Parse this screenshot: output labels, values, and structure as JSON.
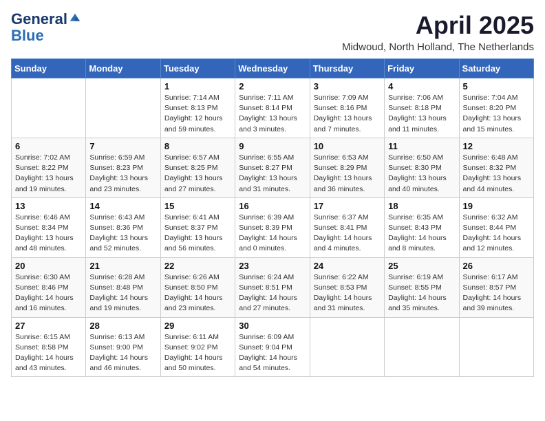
{
  "logo": {
    "line1": "General",
    "line2": "Blue"
  },
  "title": "April 2025",
  "subtitle": "Midwoud, North Holland, The Netherlands",
  "weekdays": [
    "Sunday",
    "Monday",
    "Tuesday",
    "Wednesday",
    "Thursday",
    "Friday",
    "Saturday"
  ],
  "weeks": [
    [
      {
        "day": "",
        "info": ""
      },
      {
        "day": "",
        "info": ""
      },
      {
        "day": "1",
        "info": "Sunrise: 7:14 AM\nSunset: 8:13 PM\nDaylight: 12 hours\nand 59 minutes."
      },
      {
        "day": "2",
        "info": "Sunrise: 7:11 AM\nSunset: 8:14 PM\nDaylight: 13 hours\nand 3 minutes."
      },
      {
        "day": "3",
        "info": "Sunrise: 7:09 AM\nSunset: 8:16 PM\nDaylight: 13 hours\nand 7 minutes."
      },
      {
        "day": "4",
        "info": "Sunrise: 7:06 AM\nSunset: 8:18 PM\nDaylight: 13 hours\nand 11 minutes."
      },
      {
        "day": "5",
        "info": "Sunrise: 7:04 AM\nSunset: 8:20 PM\nDaylight: 13 hours\nand 15 minutes."
      }
    ],
    [
      {
        "day": "6",
        "info": "Sunrise: 7:02 AM\nSunset: 8:22 PM\nDaylight: 13 hours\nand 19 minutes."
      },
      {
        "day": "7",
        "info": "Sunrise: 6:59 AM\nSunset: 8:23 PM\nDaylight: 13 hours\nand 23 minutes."
      },
      {
        "day": "8",
        "info": "Sunrise: 6:57 AM\nSunset: 8:25 PM\nDaylight: 13 hours\nand 27 minutes."
      },
      {
        "day": "9",
        "info": "Sunrise: 6:55 AM\nSunset: 8:27 PM\nDaylight: 13 hours\nand 31 minutes."
      },
      {
        "day": "10",
        "info": "Sunrise: 6:53 AM\nSunset: 8:29 PM\nDaylight: 13 hours\nand 36 minutes."
      },
      {
        "day": "11",
        "info": "Sunrise: 6:50 AM\nSunset: 8:30 PM\nDaylight: 13 hours\nand 40 minutes."
      },
      {
        "day": "12",
        "info": "Sunrise: 6:48 AM\nSunset: 8:32 PM\nDaylight: 13 hours\nand 44 minutes."
      }
    ],
    [
      {
        "day": "13",
        "info": "Sunrise: 6:46 AM\nSunset: 8:34 PM\nDaylight: 13 hours\nand 48 minutes."
      },
      {
        "day": "14",
        "info": "Sunrise: 6:43 AM\nSunset: 8:36 PM\nDaylight: 13 hours\nand 52 minutes."
      },
      {
        "day": "15",
        "info": "Sunrise: 6:41 AM\nSunset: 8:37 PM\nDaylight: 13 hours\nand 56 minutes."
      },
      {
        "day": "16",
        "info": "Sunrise: 6:39 AM\nSunset: 8:39 PM\nDaylight: 14 hours\nand 0 minutes."
      },
      {
        "day": "17",
        "info": "Sunrise: 6:37 AM\nSunset: 8:41 PM\nDaylight: 14 hours\nand 4 minutes."
      },
      {
        "day": "18",
        "info": "Sunrise: 6:35 AM\nSunset: 8:43 PM\nDaylight: 14 hours\nand 8 minutes."
      },
      {
        "day": "19",
        "info": "Sunrise: 6:32 AM\nSunset: 8:44 PM\nDaylight: 14 hours\nand 12 minutes."
      }
    ],
    [
      {
        "day": "20",
        "info": "Sunrise: 6:30 AM\nSunset: 8:46 PM\nDaylight: 14 hours\nand 16 minutes."
      },
      {
        "day": "21",
        "info": "Sunrise: 6:28 AM\nSunset: 8:48 PM\nDaylight: 14 hours\nand 19 minutes."
      },
      {
        "day": "22",
        "info": "Sunrise: 6:26 AM\nSunset: 8:50 PM\nDaylight: 14 hours\nand 23 minutes."
      },
      {
        "day": "23",
        "info": "Sunrise: 6:24 AM\nSunset: 8:51 PM\nDaylight: 14 hours\nand 27 minutes."
      },
      {
        "day": "24",
        "info": "Sunrise: 6:22 AM\nSunset: 8:53 PM\nDaylight: 14 hours\nand 31 minutes."
      },
      {
        "day": "25",
        "info": "Sunrise: 6:19 AM\nSunset: 8:55 PM\nDaylight: 14 hours\nand 35 minutes."
      },
      {
        "day": "26",
        "info": "Sunrise: 6:17 AM\nSunset: 8:57 PM\nDaylight: 14 hours\nand 39 minutes."
      }
    ],
    [
      {
        "day": "27",
        "info": "Sunrise: 6:15 AM\nSunset: 8:58 PM\nDaylight: 14 hours\nand 43 minutes."
      },
      {
        "day": "28",
        "info": "Sunrise: 6:13 AM\nSunset: 9:00 PM\nDaylight: 14 hours\nand 46 minutes."
      },
      {
        "day": "29",
        "info": "Sunrise: 6:11 AM\nSunset: 9:02 PM\nDaylight: 14 hours\nand 50 minutes."
      },
      {
        "day": "30",
        "info": "Sunrise: 6:09 AM\nSunset: 9:04 PM\nDaylight: 14 hours\nand 54 minutes."
      },
      {
        "day": "",
        "info": ""
      },
      {
        "day": "",
        "info": ""
      },
      {
        "day": "",
        "info": ""
      }
    ]
  ]
}
